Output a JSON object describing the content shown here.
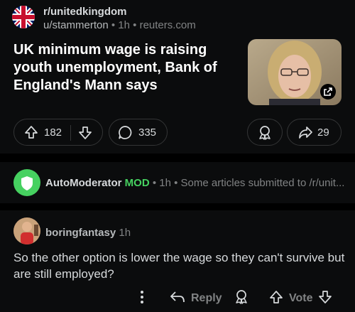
{
  "post": {
    "subreddit": "r/unitedkingdom",
    "author": "u/stammerton",
    "age": "1h",
    "domain": "reuters.com",
    "title": "UK minimum wage is raising youth unemployment, Bank of England's Mann says",
    "upvotes": "182",
    "comments": "335",
    "shares": "29"
  },
  "automod": {
    "name": "AutoModerator",
    "badge": "MOD",
    "age": "1h",
    "preview": "Some articles submitted to /r/unit..."
  },
  "comment": {
    "author": "boringfantasy",
    "age": "1h",
    "body": "So the other option is lower the wage so they can't survive but are still employed?",
    "reply_label": "Reply",
    "vote_label": "Vote"
  },
  "colors": {
    "background": "#0b0c0d",
    "mod_green": "#46d160",
    "text": "#d7dadc",
    "muted": "#818384"
  },
  "icons": [
    "union-flag-icon",
    "upvote-icon",
    "downvote-icon",
    "comment-icon",
    "award-icon",
    "share-icon",
    "external-link-icon",
    "shield-icon",
    "more-icon",
    "reply-icon"
  ]
}
